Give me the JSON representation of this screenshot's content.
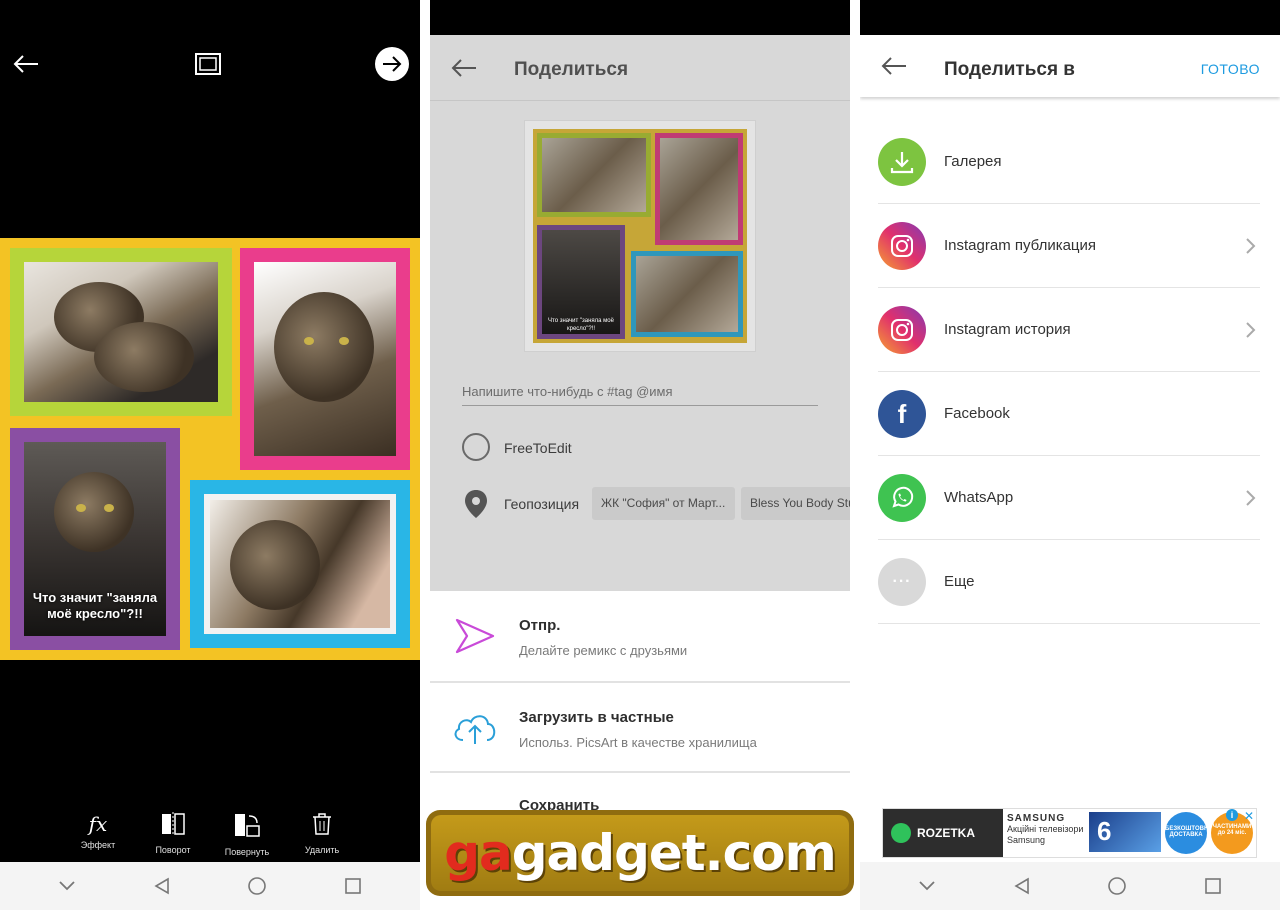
{
  "editor": {
    "caption": "Что значит \"заняла моё кресло\"?!!",
    "tools": [
      {
        "label": "Эффект",
        "icon": "fx-icon"
      },
      {
        "label": "Поворот",
        "icon": "flip-icon"
      },
      {
        "label": "Повернуть",
        "icon": "rotate-icon"
      },
      {
        "label": "Удалить",
        "icon": "trash-icon"
      }
    ]
  },
  "share": {
    "title": "Поделиться",
    "placeholder": "Напишите что-нибудь с #tag @имя",
    "free_to_edit": "FreeToEdit",
    "geo_label": "Геопозиция",
    "geo_chips": [
      "ЖК \"София\" от Март...",
      "Bless You Body Stu"
    ],
    "thumb_caption": "Что значит \"заняла моё кресло\"?!!",
    "rows": [
      {
        "title": "Отпр.",
        "subtitle": "Делайте ремикс с друзьями"
      },
      {
        "title": "Загрузить в частные",
        "subtitle": "Использ. PicsArt в качестве хранилища"
      },
      {
        "title": "Сохранить",
        "subtitle": ""
      }
    ],
    "watermark": {
      "a": "ga",
      "b": "gadget.com"
    }
  },
  "share_to": {
    "title": "Поделиться в",
    "done": "ГОТОВО",
    "items": [
      {
        "label": "Галерея",
        "icon": "download-icon",
        "color": "#7dc440"
      },
      {
        "label": "Instagram публикация",
        "icon": "instagram-icon",
        "color": "#c13584"
      },
      {
        "label": "Instagram история",
        "icon": "instagram-icon",
        "color": "#c13584"
      },
      {
        "label": "Facebook",
        "icon": "facebook-icon",
        "color": "#2f5597"
      },
      {
        "label": "WhatsApp",
        "icon": "whatsapp-icon",
        "color": "#3fc351"
      },
      {
        "label": "Еще",
        "icon": "more-icon",
        "color": "#d9d9d9"
      }
    ],
    "ad": {
      "brand": "ROZETKA",
      "samsung": "SAMSUNG",
      "line1": "Акційні телевізори",
      "line2": "Samsung",
      "tv_number": "6",
      "badge1": "БЕЗКОШТОВНА ДОСТАВКА",
      "badge2": "ЧАСТИНАМИ до 24 міс."
    }
  },
  "colors": {
    "accent": "#1e9be0",
    "collage_bg": "#f3c324"
  }
}
